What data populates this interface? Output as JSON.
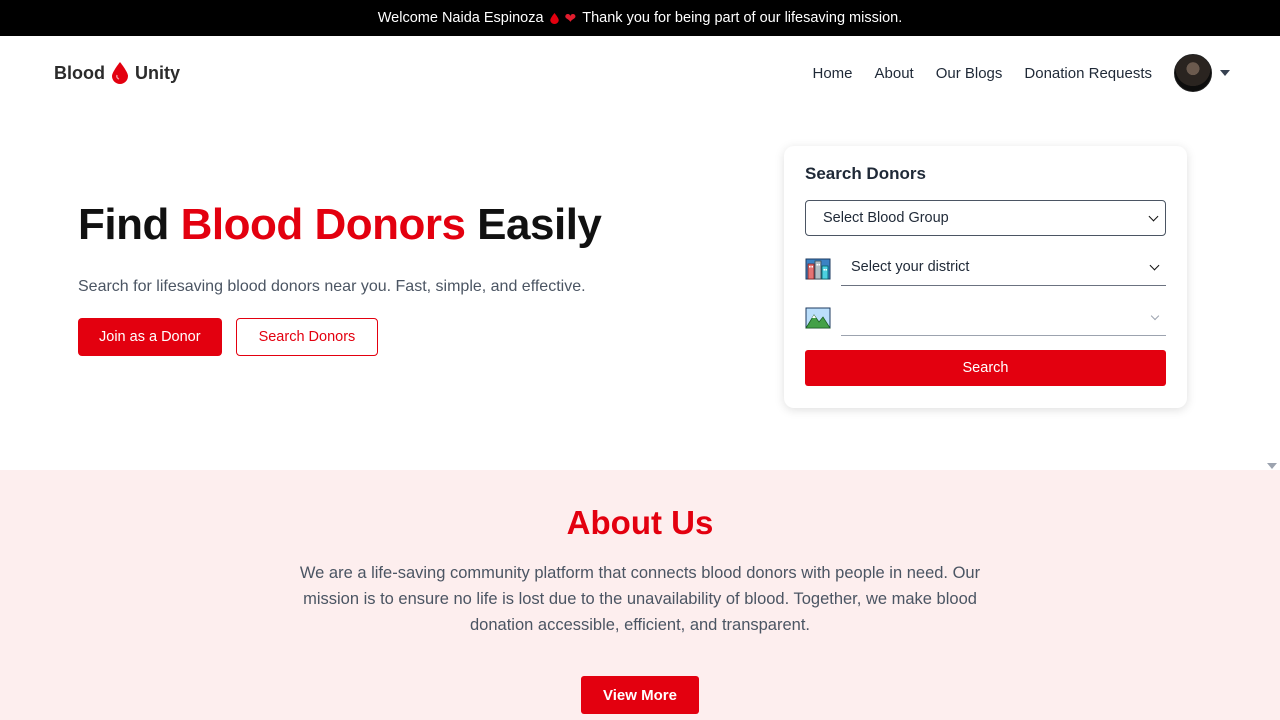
{
  "topbar": {
    "welcome": "Welcome Naida Espinoza",
    "message": "Thank you for being part of our lifesaving mission."
  },
  "logo": {
    "left": "Blood",
    "right": "Unity"
  },
  "nav": {
    "links": [
      "Home",
      "About",
      "Our Blogs",
      "Donation Requests"
    ]
  },
  "hero": {
    "title_part1": "Find ",
    "title_highlight": "Blood Donors",
    "title_part2": " Easily",
    "subtitle": "Search for lifesaving blood donors near you. Fast, simple, and effective.",
    "join_button": "Join as a Donor",
    "search_button": "Search Donors"
  },
  "search_card": {
    "title": "Search Donors",
    "blood_group_placeholder": "Select Blood Group",
    "district_placeholder": "Select your district",
    "upazila_value": "",
    "search_button": "Search"
  },
  "about": {
    "title": "About Us",
    "text": "We are a life-saving community platform that connects blood donors with people in need. Our mission is to ensure no life is lost due to the unavailability of blood. Together, we make blood donation accessible, efficient, and transparent.",
    "button": "View More"
  },
  "colors": {
    "brand_red": "#e3000f",
    "about_bg": "#fdeeee",
    "topbar_bg": "#000000"
  },
  "icons": [
    "blood-drop-icon",
    "heart-icon",
    "avatar",
    "city-icon",
    "landscape-icon",
    "chevron-down-icon"
  ]
}
